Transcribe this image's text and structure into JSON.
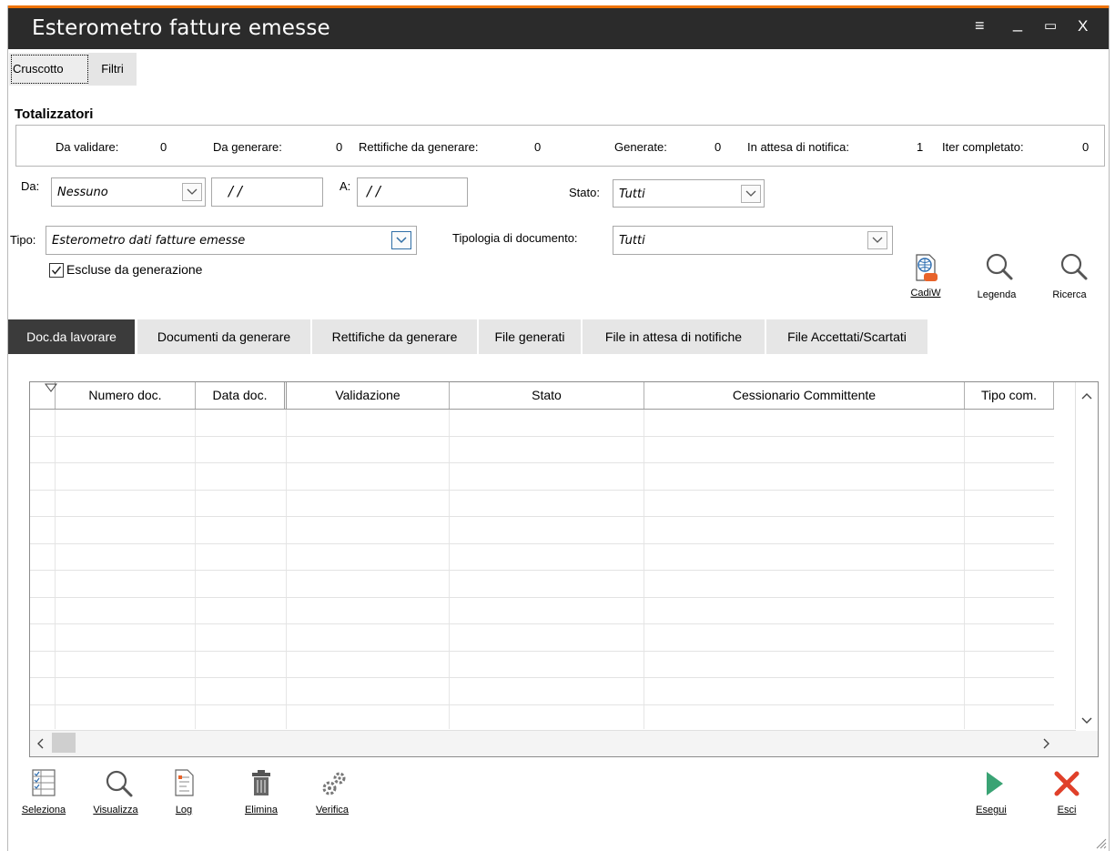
{
  "window": {
    "title": "Esterometro fatture emesse",
    "controls": {
      "menu": "≡",
      "minimize": "_",
      "maximize": "▭",
      "close": "X"
    },
    "accent_color": "#ee7202"
  },
  "top_tabs": [
    {
      "label": "Cruscotto",
      "active": true
    },
    {
      "label": "Filtri",
      "active": false
    }
  ],
  "totalizzatori": {
    "title": "Totalizzatori",
    "items": [
      {
        "label": "Da validare:",
        "value": "0"
      },
      {
        "label": "Da generare:",
        "value": "0"
      },
      {
        "label": "Rettifiche da generare:",
        "value": "0"
      },
      {
        "label": "Generate:",
        "value": "0"
      },
      {
        "label": "In attesa di notifica:",
        "value": "1"
      },
      {
        "label": "Iter completato:",
        "value": "0"
      }
    ]
  },
  "filters": {
    "da_label": "Da:",
    "da_value": "Nessuno",
    "da_date": "/ /",
    "a_label": "A:",
    "a_date": "/ /",
    "stato_label": "Stato:",
    "stato_value": "Tutti",
    "tipo_label": "Tipo:",
    "tipo_value": "Esterometro dati fatture emesse",
    "tipologia_label": "Tipologia di documento:",
    "tipologia_value": "Tutti",
    "escluse_label": "Escluse da generazione",
    "escluse_checked": true
  },
  "tool_buttons": {
    "cadiw": "CadiW",
    "legenda": "Legenda",
    "ricerca": "Ricerca"
  },
  "doc_tabs": [
    {
      "label": "Doc.da lavorare",
      "active": true
    },
    {
      "label": "Documenti da generare",
      "active": false
    },
    {
      "label": "Rettifiche da generare",
      "active": false
    },
    {
      "label": "File generati",
      "active": false
    },
    {
      "label": "File in attesa di notifiche",
      "active": false
    },
    {
      "label": "File Accettati/Scartati",
      "active": false
    }
  ],
  "grid": {
    "columns": [
      "Numero doc.",
      "Data doc.",
      "Validazione",
      "Stato",
      "Cessionario Committente",
      "Tipo com."
    ],
    "rows": []
  },
  "bottom_buttons": {
    "seleziona": "Seleziona",
    "visualizza": "Visualizza",
    "log": "Log",
    "elimina": "Elimina",
    "verifica": "Verifica",
    "esegui": "Esegui",
    "esci": "Esci"
  },
  "colors": {
    "run_green": "#3aa374",
    "exit_red": "#e0402a"
  }
}
